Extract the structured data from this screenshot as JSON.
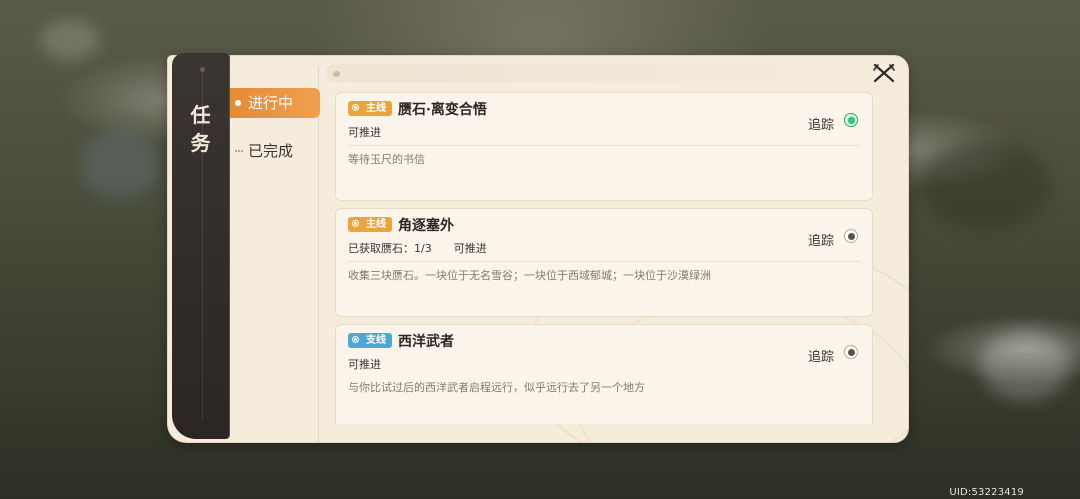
{
  "panel": {
    "title_chars": [
      "任",
      "务"
    ]
  },
  "nav": {
    "items": [
      {
        "label": "进行中",
        "active": true
      },
      {
        "label": "已完成",
        "active": false
      }
    ]
  },
  "quests": [
    {
      "type": "主线",
      "type_kind": "main",
      "title": "赝石·离变合悟",
      "status": "可推进",
      "progress": "",
      "description": "等待玉尺的书信",
      "track_label": "追踪",
      "tracking": true
    },
    {
      "type": "主线",
      "type_kind": "main",
      "title": "角逐塞外",
      "status": "可推进",
      "progress": "已获取赝石：1/3",
      "description": "收集三块赝石。一块位于无名雪谷；一块位于西域郁城；一块位于沙漠绿洲",
      "track_label": "追踪",
      "tracking": false
    },
    {
      "type": "支线",
      "type_kind": "side",
      "title": "西洋武者",
      "status": "可推进",
      "progress": "",
      "description": "与你比试过后的西洋武者启程远行，似乎远行去了另一个地方",
      "track_label": "追踪",
      "tracking": false
    }
  ],
  "footer": {
    "uid": "UID:53223419"
  },
  "colors": {
    "accent_orange": "#e58a35",
    "main_tag": "#e9a43e",
    "side_tag": "#4fa7d8",
    "tracking_green": "#37c274"
  }
}
